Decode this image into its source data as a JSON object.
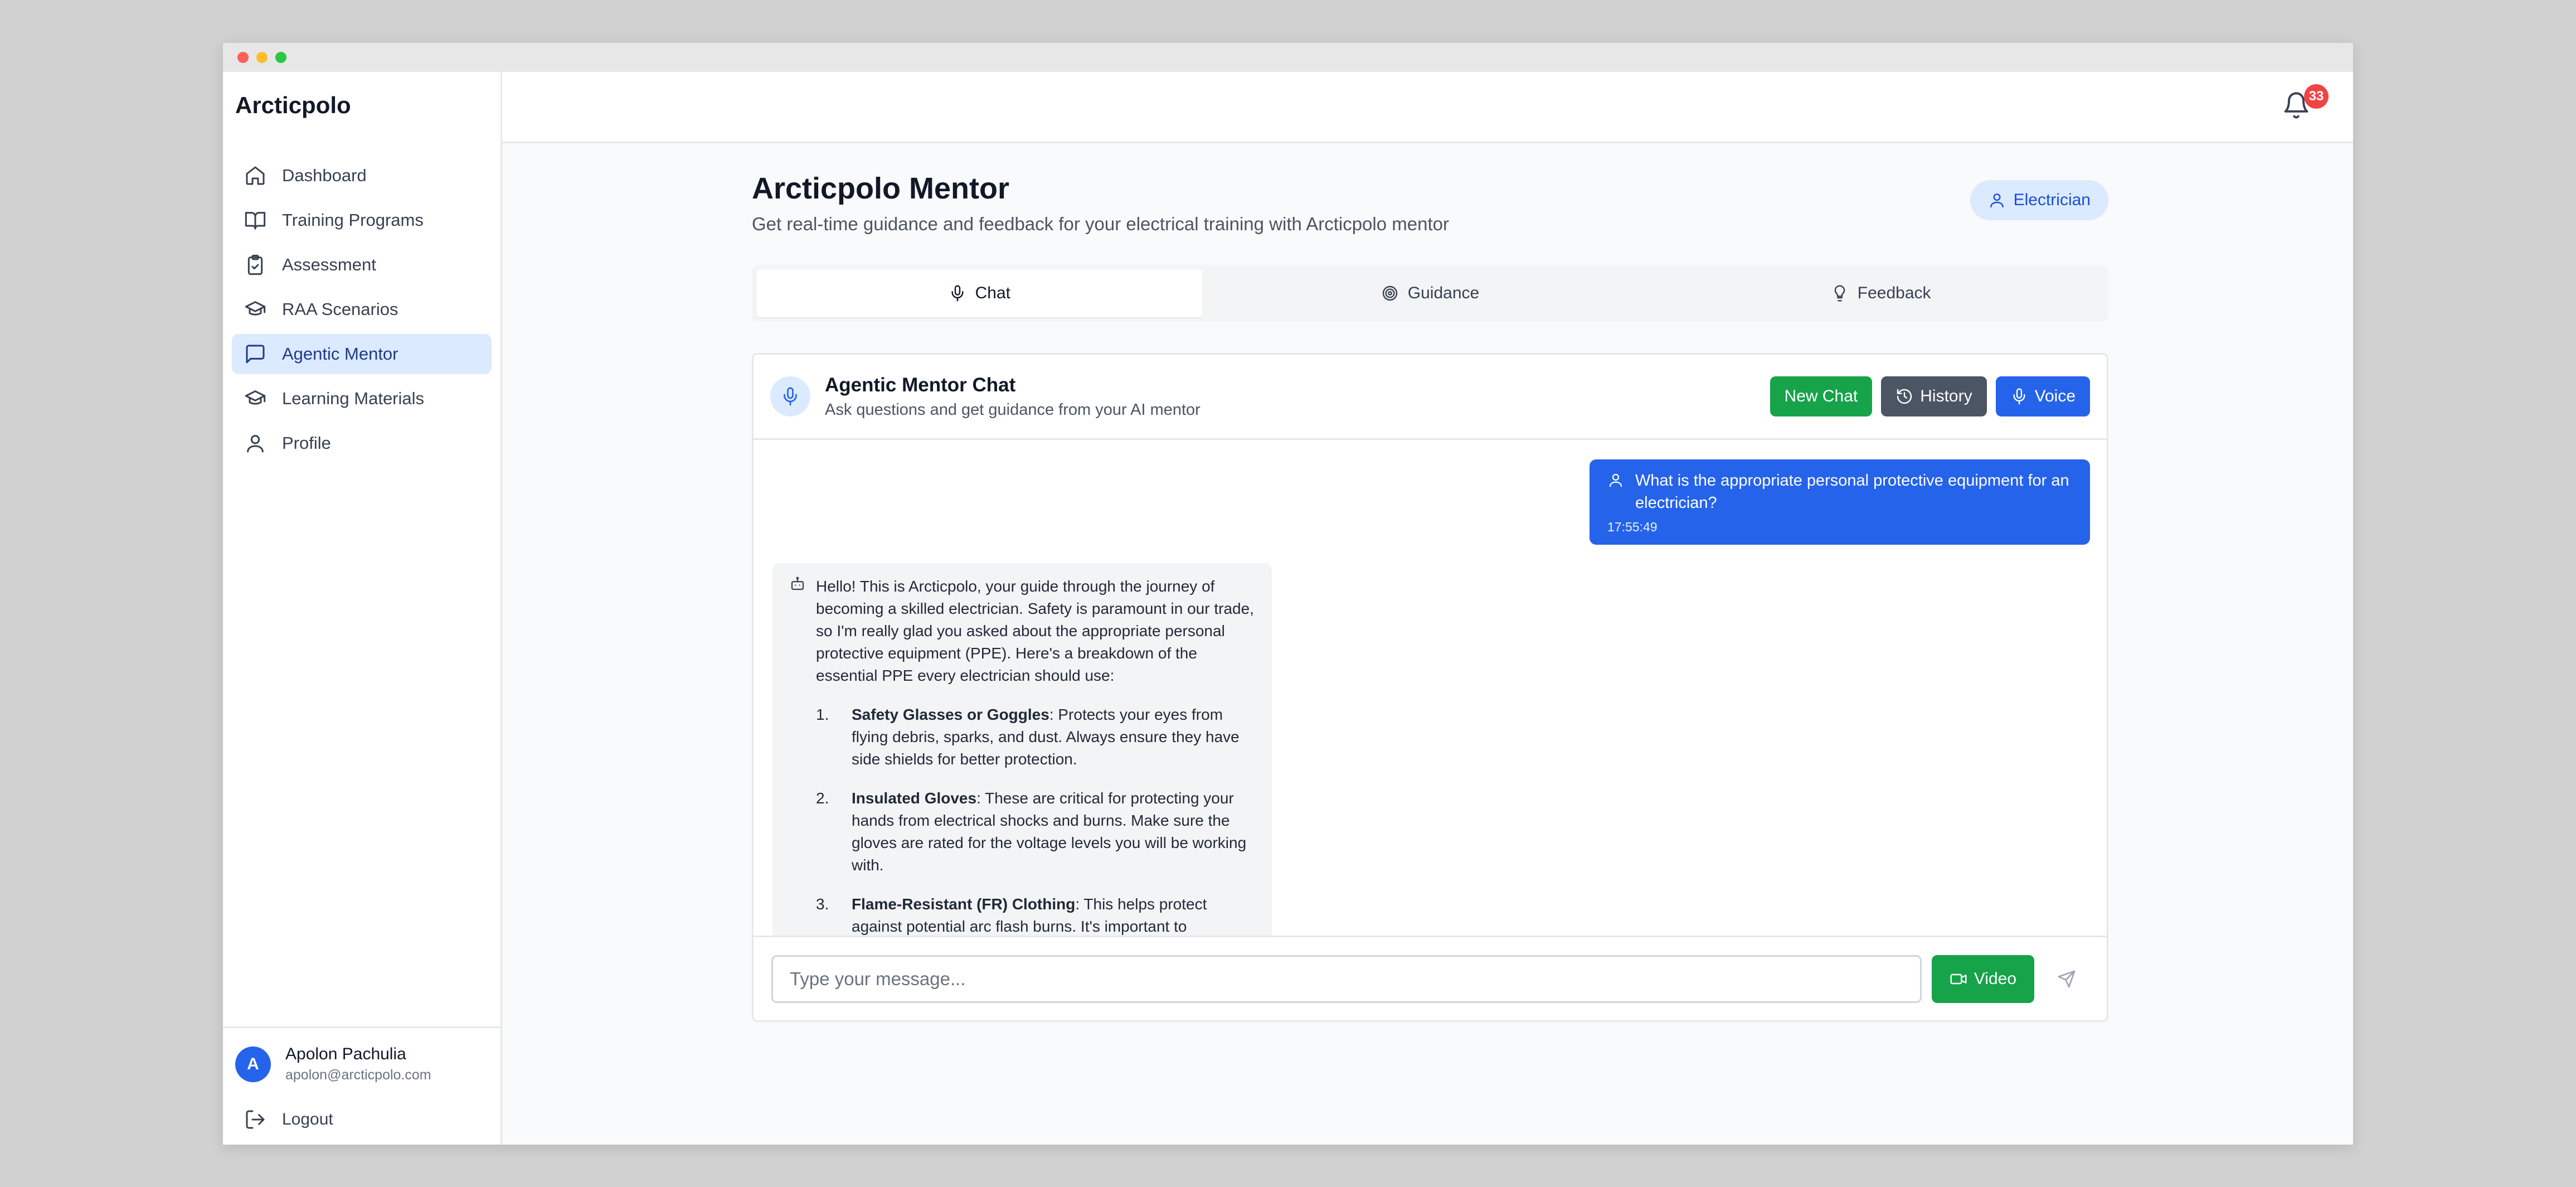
{
  "app": {
    "brand": "Arcticpolo"
  },
  "sidebar": {
    "items": [
      {
        "label": "Dashboard",
        "icon": "home-icon",
        "active": false
      },
      {
        "label": "Training Programs",
        "icon": "book-icon",
        "active": false
      },
      {
        "label": "Assessment",
        "icon": "clipboard-icon",
        "active": false
      },
      {
        "label": "RAA Scenarios",
        "icon": "graduation-cap-icon",
        "active": false
      },
      {
        "label": "Agentic Mentor",
        "icon": "message-square-icon",
        "active": true
      },
      {
        "label": "Learning Materials",
        "icon": "graduation-cap-icon",
        "active": false
      },
      {
        "label": "Profile",
        "icon": "user-icon",
        "active": false
      }
    ],
    "user": {
      "initial": "A",
      "name": "Apolon Pachulia",
      "email": "apolon@arcticpolo.com"
    },
    "logout_label": "Logout"
  },
  "topbar": {
    "notification_count": "33"
  },
  "page": {
    "title": "Arcticpolo Mentor",
    "subtitle": "Get real-time guidance and feedback for your electrical training with Arcticpolo mentor",
    "role_badge": "Electrician"
  },
  "tabs": [
    {
      "label": "Chat",
      "icon": "mic-icon",
      "active": true
    },
    {
      "label": "Guidance",
      "icon": "target-icon",
      "active": false
    },
    {
      "label": "Feedback",
      "icon": "lightbulb-icon",
      "active": false
    }
  ],
  "chat": {
    "title": "Agentic Mentor Chat",
    "subtitle": "Ask questions and get guidance from your AI mentor",
    "new_chat_label": "New Chat",
    "history_label": "History",
    "voice_label": "Voice",
    "user_message": {
      "text": "What is the appropriate personal protective equipment for an electrician?",
      "time": "17:55:49"
    },
    "bot_message": {
      "intro": "Hello! This is Arcticpolo, your guide through the journey of becoming a skilled electrician. Safety is paramount in our trade, so I'm really glad you asked about the appropriate personal protective equipment (PPE). Here's a breakdown of the essential PPE every electrician should use:",
      "items": [
        {
          "num": "1.",
          "title": "Safety Glasses or Goggles",
          "text": ": Protects your eyes from flying debris, sparks, and dust. Always ensure they have side shields for better protection."
        },
        {
          "num": "2.",
          "title": "Insulated Gloves",
          "text": ": These are critical for protecting your hands from electrical shocks and burns. Make sure the gloves are rated for the voltage levels you will be working with."
        },
        {
          "num": "3.",
          "title": "Flame-Resistant (FR) Clothing",
          "text": ": This helps protect against potential arc flash burns. It's important to"
        }
      ]
    },
    "input_placeholder": "Type your message...",
    "video_label": "Video"
  }
}
